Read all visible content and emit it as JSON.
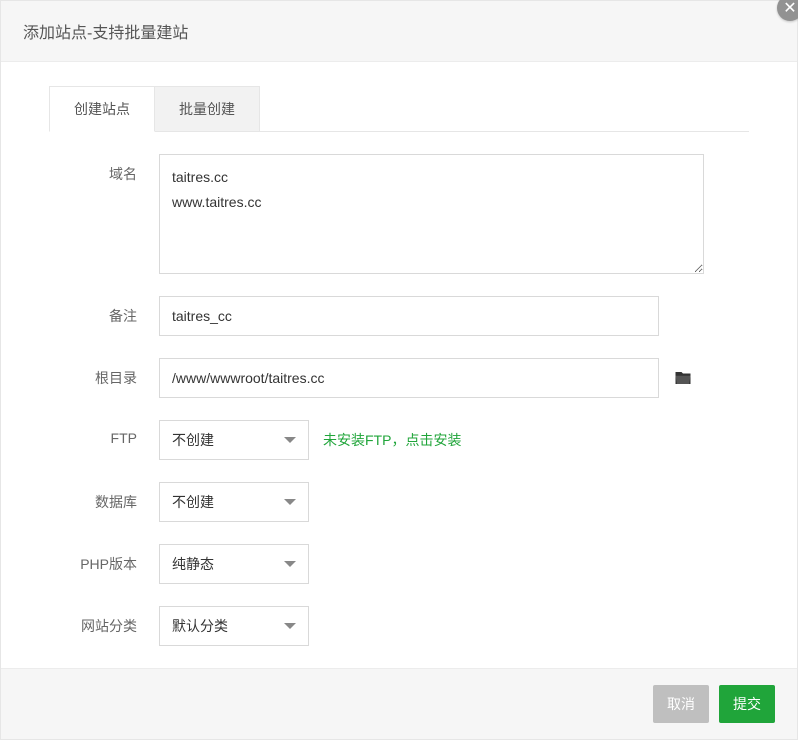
{
  "header": {
    "title": "添加站点-支持批量建站"
  },
  "tabs": {
    "create": "创建站点",
    "batch": "批量创建"
  },
  "labels": {
    "domain": "域名",
    "remark": "备注",
    "root": "根目录",
    "ftp": "FTP",
    "db": "数据库",
    "php": "PHP版本",
    "cat": "网站分类"
  },
  "values": {
    "domain": "taitres.cc\nwww.taitres.cc",
    "remark": "taitres_cc",
    "root": "/www/wwwroot/taitres.cc",
    "ftp": "不创建",
    "db": "不创建",
    "php": "纯静态",
    "cat": "默认分类"
  },
  "hints": {
    "ftp_pre": "未安装FTP，",
    "ftp_link": "点击安装"
  },
  "footer": {
    "cancel": "取消",
    "submit": "提交"
  }
}
